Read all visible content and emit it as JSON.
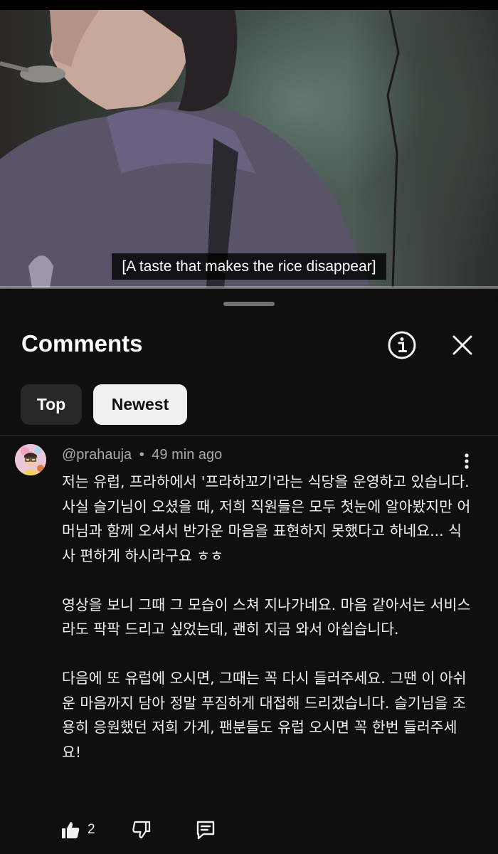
{
  "video": {
    "caption": "[A taste that makes the rice disappear]",
    "progress_fraction": 1.0
  },
  "panel": {
    "title": "Comments",
    "info_icon": "info-icon",
    "close_icon": "close-icon",
    "filters": [
      {
        "label": "Top",
        "selected": false
      },
      {
        "label": "Newest",
        "selected": true
      }
    ]
  },
  "comment": {
    "author": "@prahauja",
    "separator": "•",
    "time": "49 min ago",
    "paragraphs": [
      "저는 유럽, 프라하에서 '프라하꼬기'라는 식당을 운영하고 있습니다. 사실 슬기님이 오셨을 때, 저희 직원들은 모두 첫눈에 알아봤지만 어머님과 함께 오셔서 반가운 마음을 표현하지 못했다고 하네요... 식사 편하게 하시라구요 ㅎㅎ",
      "영상을 보니 그때 그 모습이 스쳐 지나가네요. 마음 같아서는 서비스라도 팍팍 드리고 싶었는데, 괜히 지금 와서 아쉽습니다.",
      "다음에 또 유럽에 오시면, 그때는 꼭 다시 들러주세요. 그땐 이 아쉬운 마음까지 담아 정말 푸짐하게 대접해 드리겠습니다. 슬기님을 조용히 응원했던 저희 가게, 팬분들도 유럽 오시면 꼭 한번 들러주세요!"
    ],
    "like_count": "2",
    "icons": {
      "like": "thumbs-up-icon",
      "dislike": "thumbs-down-icon",
      "reply": "reply-icon",
      "more": "more-vertical-icon"
    }
  }
}
